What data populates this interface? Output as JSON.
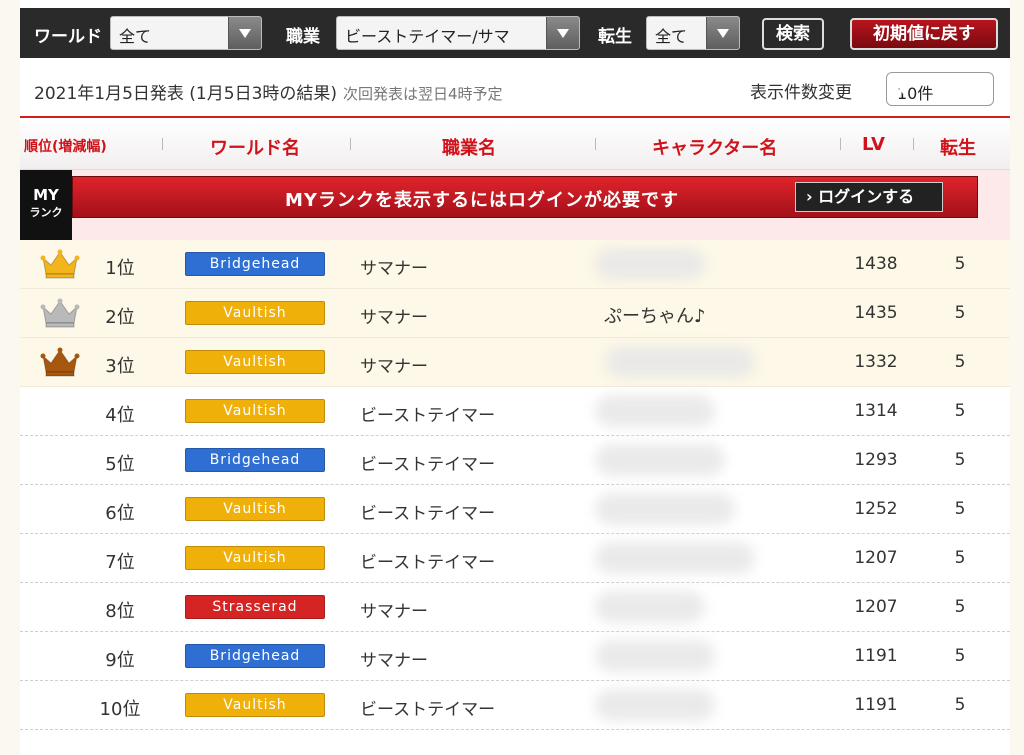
{
  "filters": {
    "world_label": "ワールド",
    "world_value": "全て",
    "job_label": "職業",
    "job_value": "ビーストテイマー/サマ",
    "reincarnation_label": "転生",
    "reincarnation_value": "全て",
    "search_button": "検索",
    "reset_button": "初期値に戻す"
  },
  "info": {
    "announcement": "2021年1月5日発表 (1月5日3時の結果)",
    "next_announcement": "次回発表は翌日4時予定",
    "count_label": "表示件数変更",
    "count_value": "10件"
  },
  "table_header": {
    "rank": "順位(増減幅)",
    "world": "ワールド名",
    "job": "職業名",
    "character": "キャラクター名",
    "lv": "LV",
    "reincarnation": "転生"
  },
  "my_rank": {
    "badge_line1": "MY",
    "badge_line2": "ランク",
    "message": "MYランクを表示するにはログインが必要です",
    "login_button": "ログインする"
  },
  "colors": {
    "accent_red": "#d0121b",
    "Bridgehead": "#2f6fd3",
    "Vaultish": "#f0b00a",
    "Strasserad": "#d42424",
    "gold_crown": "#f3b51c",
    "silver_crown": "#b9b9b9",
    "bronze_crown": "#a8570f"
  },
  "rows": [
    {
      "rank": "1位",
      "world": "Bridgehead",
      "job": "サマナー",
      "character": "",
      "lv": "1438",
      "reincarnation": "5",
      "crown": "gold-crown-icon"
    },
    {
      "rank": "2位",
      "world": "Vaultish",
      "job": "サマナー",
      "character": "ぷーちゃん♪",
      "lv": "1435",
      "reincarnation": "5",
      "crown": "silver-crown-icon"
    },
    {
      "rank": "3位",
      "world": "Vaultish",
      "job": "サマナー",
      "character": "",
      "lv": "1332",
      "reincarnation": "5",
      "crown": "bronze-crown-icon"
    },
    {
      "rank": "4位",
      "world": "Vaultish",
      "job": "ビーストテイマー",
      "character": "",
      "lv": "1314",
      "reincarnation": "5",
      "crown": ""
    },
    {
      "rank": "5位",
      "world": "Bridgehead",
      "job": "ビーストテイマー",
      "character": "",
      "lv": "1293",
      "reincarnation": "5",
      "crown": ""
    },
    {
      "rank": "6位",
      "world": "Vaultish",
      "job": "ビーストテイマー",
      "character": "",
      "lv": "1252",
      "reincarnation": "5",
      "crown": ""
    },
    {
      "rank": "7位",
      "world": "Vaultish",
      "job": "ビーストテイマー",
      "character": "",
      "lv": "1207",
      "reincarnation": "5",
      "crown": ""
    },
    {
      "rank": "8位",
      "world": "Strasserad",
      "job": "サマナー",
      "character": "",
      "lv": "1207",
      "reincarnation": "5",
      "crown": ""
    },
    {
      "rank": "9位",
      "world": "Bridgehead",
      "job": "サマナー",
      "character": "",
      "lv": "1191",
      "reincarnation": "5",
      "crown": ""
    },
    {
      "rank": "10位",
      "world": "Vaultish",
      "job": "ビーストテイマー",
      "character": "",
      "lv": "1191",
      "reincarnation": "5",
      "crown": ""
    }
  ]
}
